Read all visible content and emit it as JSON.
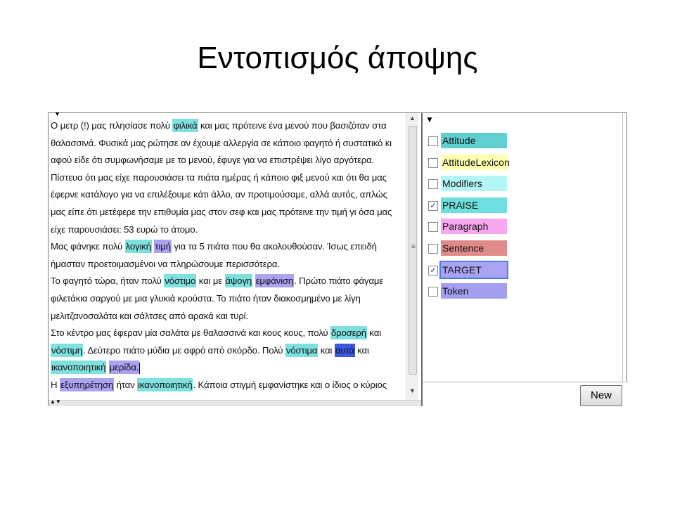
{
  "slide": {
    "title": "Εντοπισμός άποψης"
  },
  "editor": {
    "lines": [
      [
        {
          "t": "Ο μετρ (!) μας πλησίασε πολύ "
        },
        {
          "t": "φιλικά",
          "c": "hl-praise"
        },
        {
          "t": " και μας πρότεινε ένα μενού που βασιζόταν στα"
        }
      ],
      [
        {
          "t": "θαλασσινά. Φυσικά μας ρώτησε αν έχουμε αλλεργία σε κάποιο φαγητό ή συστατικό κι"
        }
      ],
      [
        {
          "t": "αφού είδε ότι συμφωνήσαμε με το μενού, έφυγε για να επιστρέψει λίγο αργότερα."
        }
      ],
      [
        {
          "t": "Πίστευα ότι μας είχε παρουσιάσει τα πιάτα ημέρας ή κάποιο φιξ μενού και ότι θα μας"
        }
      ],
      [
        {
          "t": "έφερνε κατάλογο για να επιλέξουμε κάτι άλλο, αν προτιμούσαμε, αλλά αυτός, απλώς"
        }
      ],
      [
        {
          "t": "μας είπε ότι μετέφερε την επιθυμία μας στον σεφ και μας πρότεινε την τιμή γι όσα μας"
        }
      ],
      [
        {
          "t": "είχε παρουσιάσει: 53 ευρώ το άτομο."
        }
      ],
      [
        {
          "t": "Μας φάνηκε πολύ "
        },
        {
          "t": "λογική",
          "c": "hl-praise"
        },
        {
          "t": " "
        },
        {
          "t": "τιμή",
          "c": "hl-target"
        },
        {
          "t": " για τα 5 πιάτα που θα ακολουθούσαν. Ίσως επειδή"
        }
      ],
      [
        {
          "t": "ήμασταν προετοιμασμένοι να πληρώσουμε περισσότερα."
        }
      ],
      [
        {
          "t": "Το φαγητό τώρα, ήταν πολύ "
        },
        {
          "t": "νόστιμο",
          "c": "hl-praise"
        },
        {
          "t": " και με "
        },
        {
          "t": "άψογη",
          "c": "hl-praise"
        },
        {
          "t": " "
        },
        {
          "t": "εμφάνιση",
          "c": "hl-target"
        },
        {
          "t": ". Πρώτο πιάτο φάγαμε"
        }
      ],
      [
        {
          "t": "φιλετάκια σαργού με μια γλυκιά κρούστα. Το πιάτο ήταν διακοσμημένο με λίγη"
        }
      ],
      [
        {
          "t": "μελιτζανοσαλάτα και σάλτσες από αρακά και τυρί."
        }
      ],
      [
        {
          "t": "Στο κέντρο μας έφεραν μία σαλάτα με θαλασσινά και κους κους, πολύ "
        },
        {
          "t": "δροσερή",
          "c": "hl-praise"
        },
        {
          "t": " και"
        }
      ],
      [
        {
          "t": "νόστιμη",
          "c": "hl-praise"
        },
        {
          "t": ". Δεύτερο πιάτο μύδια με αφρό από σκόρδο. Πολύ "
        },
        {
          "t": "νόστιμα",
          "c": "hl-praise"
        },
        {
          "t": " και "
        },
        {
          "t": "αυτά",
          "c": "hl-target-dark"
        },
        {
          "t": " και"
        }
      ],
      [
        {
          "t": "ικανοποιητική",
          "c": "hl-praise"
        },
        {
          "t": " "
        },
        {
          "t": "μερίδα.",
          "c": "hl-target"
        },
        {
          "caret": true
        }
      ],
      [
        {
          "t": "Η "
        },
        {
          "t": "εξυπηρέτηση",
          "c": "hl-target"
        },
        {
          "t": " ήταν "
        },
        {
          "t": "ικανοποιητική",
          "c": "hl-praise"
        },
        {
          "t": ". Κάποια στιγμή εμφανίστηκε και ο ίδιος ο κύριος"
        }
      ]
    ]
  },
  "types": [
    {
      "label": "Attitude",
      "color": "#5fcfcf",
      "checked": false
    },
    {
      "label": "AttitudeLexicon",
      "color": "#ffffb0",
      "checked": false
    },
    {
      "label": "Modifiers",
      "color": "#b3f6f6",
      "checked": false
    },
    {
      "label": "PRAISE",
      "color": "#6fdede",
      "checked": true
    },
    {
      "label": "Paragraph",
      "color": "#f7a8ee",
      "checked": false
    },
    {
      "label": "Sentence",
      "color": "#e08a8a",
      "checked": false
    },
    {
      "label": "TARGET",
      "color": "#a9a3f2",
      "checked": true,
      "selected": true
    },
    {
      "label": "Token",
      "color": "#a39ef0",
      "checked": false
    }
  ],
  "buttons": {
    "new_label": "New"
  },
  "icons": {
    "collapse": "triangle-down-icon",
    "check": "checkmark-icon"
  }
}
